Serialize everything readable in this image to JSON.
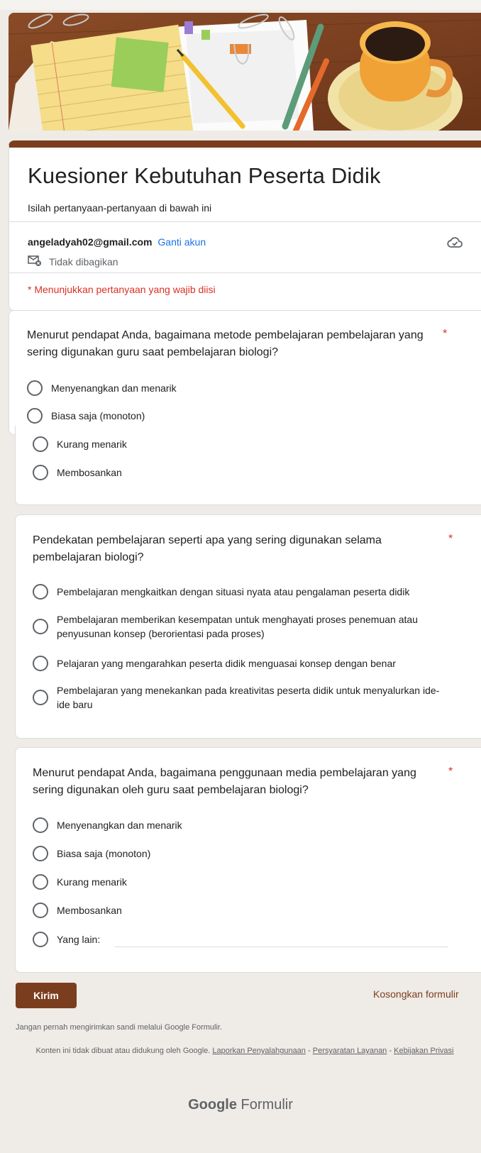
{
  "form": {
    "title": "Kuesioner Kebutuhan Peserta Didik",
    "description": "Isilah pertanyaan-pertanyaan di bawah ini",
    "account_email": "angeladyah02@gmail.com",
    "switch_account": "Ganti akun",
    "not_shared": "Tidak dibagikan",
    "required_note": "* Menunjukkan pertanyaan yang wajib diisi"
  },
  "questions": [
    {
      "text": "Menurut pendapat Anda, bagaimana metode pembelajaran pembelajaran yang sering digunakan guru saat pembelajaran biologi?",
      "required": "*",
      "options": [
        "Menyenangkan dan menarik",
        "Biasa saja (monoton)",
        "Kurang menarik",
        "Membosankan"
      ]
    },
    {
      "text": "Pendekatan pembelajaran seperti apa yang sering digunakan selama pembelajaran biologi?",
      "required": "*",
      "options": [
        "Pembelajaran mengkaitkan dengan situasi nyata atau pengalaman peserta didik",
        "Pembelajaran memberikan kesempatan untuk menghayati proses penemuan atau penyusunan konsep (berorientasi pada proses)",
        "Pelajaran yang mengarahkan peserta didik menguasai konsep dengan benar",
        "Pembelajaran yang menekankan pada kreativitas peserta didik untuk menyalurkan ide-ide baru"
      ]
    },
    {
      "text": "Menurut pendapat Anda, bagaimana penggunaan media pembelajaran yang sering digunakan oleh guru saat pembelajaran biologi?",
      "required": "*",
      "options": [
        "Menyenangkan dan menarik",
        "Biasa saja (monoton)",
        "Kurang menarik",
        "Membosankan",
        "Yang lain:"
      ]
    }
  ],
  "actions": {
    "submit": "Kirim",
    "clear": "Kosongkan formulir"
  },
  "footer": {
    "password_warning": "Jangan pernah mengirimkan sandi melalui Google Formulir.",
    "disclaimer_prefix": "Konten ini tidak dibuat atau didukung oleh Google.",
    "report_abuse": "Laporkan Penyalahgunaan",
    "terms": "Persyaratan Layanan",
    "privacy": "Kebijakan Privasi",
    "sep": "-",
    "brand_google": "Google",
    "brand_forms": "Formulir"
  },
  "colors": {
    "theme": "#7a3e1e",
    "required": "#d93025",
    "link": "#1a73e8",
    "background": "#efebe6"
  }
}
